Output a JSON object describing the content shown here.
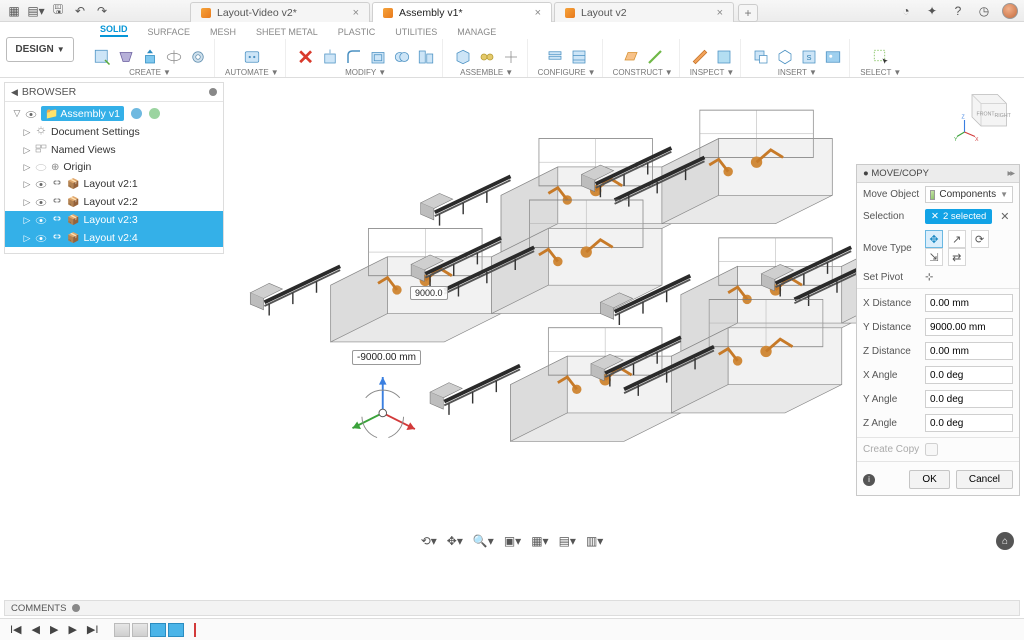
{
  "titlebar": {
    "tabs": [
      {
        "label": "Layout-Video v2*",
        "active": false
      },
      {
        "label": "Assembly v1*",
        "active": true
      },
      {
        "label": "Layout v2",
        "active": false
      }
    ],
    "newtab": "+"
  },
  "design_button": "DESIGN",
  "ribbon": {
    "tabs": [
      "SOLID",
      "SURFACE",
      "MESH",
      "SHEET METAL",
      "PLASTIC",
      "UTILITIES",
      "MANAGE"
    ],
    "active_tab": "SOLID",
    "groups": {
      "create": "CREATE",
      "automate": "AUTOMATE",
      "modify": "MODIFY",
      "assemble": "ASSEMBLE",
      "configure": "CONFIGURE",
      "construct": "CONSTRUCT",
      "inspect": "INSPECT",
      "insert": "INSERT",
      "select": "SELECT"
    }
  },
  "browser": {
    "title": "BROWSER",
    "root": "Assembly v1",
    "items": [
      {
        "label": "Document Settings",
        "icon": "gear"
      },
      {
        "label": "Named Views",
        "icon": "views"
      },
      {
        "label": "Origin",
        "icon": "origin"
      },
      {
        "label": "Layout v2:1",
        "icon": "link",
        "link": true
      },
      {
        "label": "Layout v2:2",
        "icon": "link",
        "link": true
      },
      {
        "label": "Layout v2:3",
        "icon": "link",
        "link": true,
        "selected": true
      },
      {
        "label": "Layout v2:4",
        "icon": "link",
        "link": true,
        "selected": true
      }
    ]
  },
  "viewcube": {
    "front": "FRONT",
    "right": "RIGHT",
    "axes": [
      "X",
      "Y",
      "Z"
    ]
  },
  "canvas": {
    "dim_small": "9000.0",
    "dim_box": "-9000.00 mm"
  },
  "move_panel": {
    "title": "MOVE/COPY",
    "rows": {
      "move_object": {
        "k": "Move Object",
        "v": "Components"
      },
      "selection": {
        "k": "Selection",
        "v": "2 selected"
      },
      "move_type": {
        "k": "Move Type"
      },
      "set_pivot": {
        "k": "Set Pivot"
      },
      "x_distance": {
        "k": "X Distance",
        "v": "0.00 mm"
      },
      "y_distance": {
        "k": "Y Distance",
        "v": "9000.00 mm"
      },
      "z_distance": {
        "k": "Z Distance",
        "v": "0.00 mm"
      },
      "x_angle": {
        "k": "X Angle",
        "v": "0.0 deg"
      },
      "y_angle": {
        "k": "Y Angle",
        "v": "0.0 deg"
      },
      "z_angle": {
        "k": "Z Angle",
        "v": "0.0 deg"
      },
      "create_copy": {
        "k": "Create Copy"
      }
    },
    "ok": "OK",
    "cancel": "Cancel"
  },
  "comments": {
    "title": "COMMENTS"
  }
}
